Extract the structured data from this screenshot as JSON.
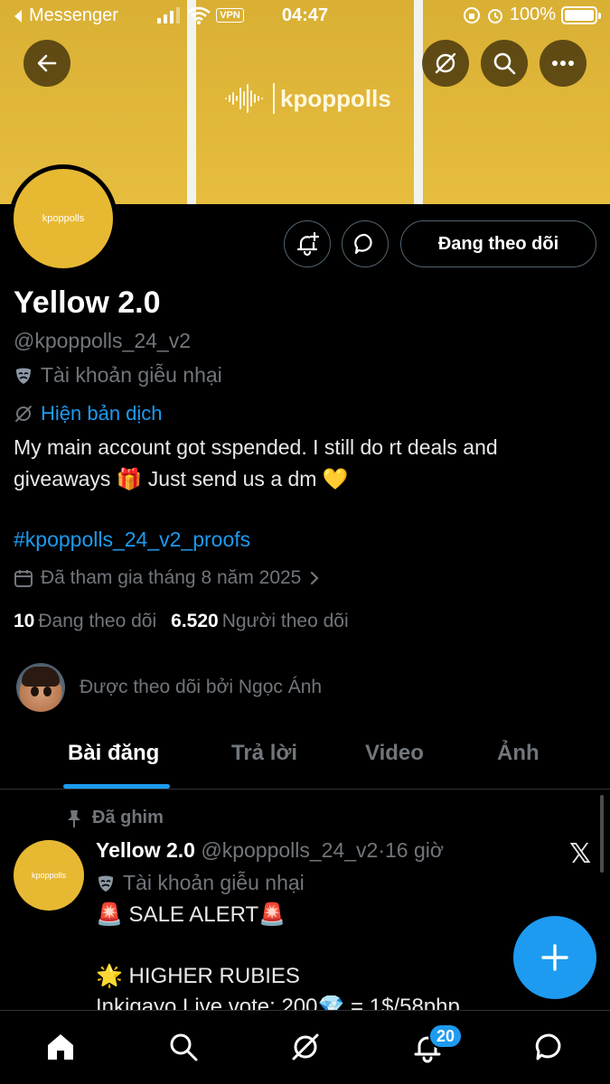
{
  "status_bar": {
    "back_app": "Messenger",
    "time": "04:47",
    "vpn": "VPN",
    "battery": "100%"
  },
  "banner": {
    "logo_text": "kpoppolls"
  },
  "avatar": {
    "logo_text": "kpoppolls"
  },
  "profile": {
    "follow_button": "Đang theo dõi",
    "name": "Yellow 2.0",
    "handle": "@kpoppolls_24_v2",
    "parody_label": "Tài khoản giễu nhại",
    "translate_link": "Hiện bản dịch",
    "bio": "My main account got sspended. I still do rt deals and giveaways 🎁 Just send us a dm 💛",
    "hashtag": "#kpoppolls_24_v2_proofs",
    "joined": "Đã tham gia tháng 8 năm 2025",
    "following_count": "10",
    "following_label": "Đang theo dõi",
    "followers_count": "6.520",
    "followers_label": "Người theo dõi",
    "followed_by": "Được theo dõi bởi Ngọc Ánh"
  },
  "tabs": [
    "Bài đăng",
    "Trả lời",
    "Video",
    "Ảnh"
  ],
  "post": {
    "pinned_label": "Đã ghim",
    "author_name": "Yellow 2.0",
    "author_handle": "@kpoppolls_24_v2",
    "separator": "·",
    "time": "16 giờ",
    "parody_label": "Tài khoản giễu nhại",
    "line1": "🚨 SALE ALERT🚨",
    "line2": "🌟 HIGHER RUBIES",
    "line3": "Inkigayo Live vote: 200💎 = 1$/58php",
    "avatar_logo": "kpoppolls"
  },
  "nav": {
    "notification_badge": "20"
  },
  "colors": {
    "accent": "#1d9bf0",
    "banner": "#e6bd3e",
    "muted": "#71767b"
  }
}
